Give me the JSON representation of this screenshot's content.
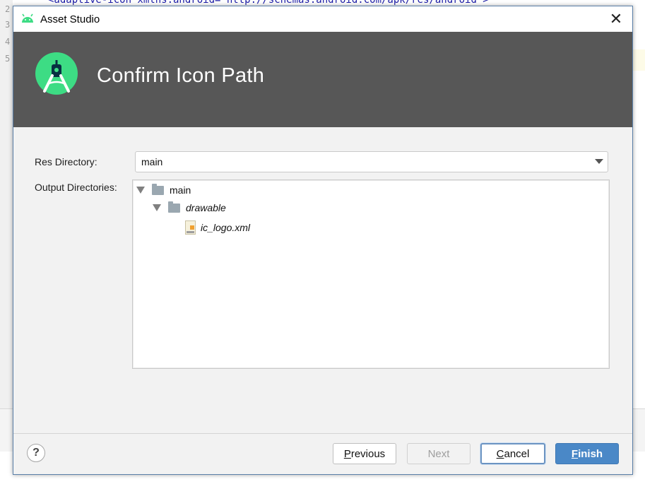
{
  "background_editor": {
    "line_numbers": [
      "2",
      "3",
      "4",
      "5"
    ],
    "code_fragment": "<adaptive-icon xmlns:android=\"http://schemas.android.com/apk/res/android\">"
  },
  "dialog": {
    "window_title": "Asset Studio",
    "close_glyph": "✕",
    "banner_title": "Confirm Icon Path",
    "res_directory": {
      "label": "Res Directory:",
      "selected": "main"
    },
    "output_directories": {
      "label": "Output Directories:",
      "tree": {
        "root": "main",
        "child": "drawable",
        "file": "ic_logo.xml"
      }
    },
    "buttons": {
      "help": "?",
      "previous_first": "P",
      "previous_rest": "revious",
      "next": "Next",
      "cancel_first": "C",
      "cancel_rest": "ancel",
      "finish_first": "F",
      "finish_rest": "inish"
    },
    "colors": {
      "banner": "#575757",
      "android_green": "#3ddc84",
      "finish_button": "#4a88c7"
    }
  }
}
